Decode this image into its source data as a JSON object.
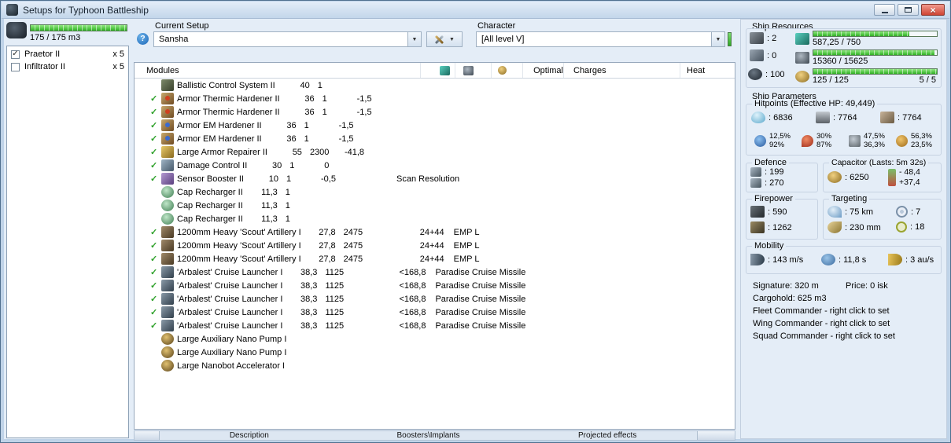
{
  "window": {
    "title": "Setups for Typhoon Battleship"
  },
  "icons": {
    "check": "✓",
    "dropdown_arrow": "▼",
    "help": "?",
    "close": "×"
  },
  "drone_bay": {
    "capacity_text": "175 / 175 m3",
    "fill_pct": 100,
    "items": [
      {
        "name": "Praetor II",
        "qty": "x 5",
        "checked": true
      },
      {
        "name": "Infiltrator II",
        "qty": "x 5",
        "checked": false
      }
    ]
  },
  "setup": {
    "current_setup_label": "Current Setup",
    "current_setup_value": "Sansha",
    "character_label": "Character",
    "character_value": "[All level V]"
  },
  "modules_table": {
    "headers": {
      "modules": "Modules",
      "optimal": "Optimal",
      "charges": "Charges",
      "heat": "Heat"
    },
    "rows": [
      {
        "active": false,
        "icon": "bcs",
        "name": "Ballistic Control System II",
        "cpu": "40",
        "pg": "1",
        "cap": "",
        "optimal": "",
        "charges": "",
        "heat": ""
      },
      {
        "active": true,
        "icon": "hard-therm",
        "name": "Armor Thermic Hardener II",
        "cpu": "36",
        "pg": "1",
        "cap": "-1,5",
        "optimal": "",
        "charges": "",
        "heat": ""
      },
      {
        "active": true,
        "icon": "hard-therm",
        "name": "Armor Thermic Hardener II",
        "cpu": "36",
        "pg": "1",
        "cap": "-1,5",
        "optimal": "",
        "charges": "",
        "heat": ""
      },
      {
        "active": true,
        "icon": "hard-em",
        "name": "Armor EM Hardener II",
        "cpu": "36",
        "pg": "1",
        "cap": "-1,5",
        "optimal": "",
        "charges": "",
        "heat": ""
      },
      {
        "active": true,
        "icon": "hard-em",
        "name": "Armor EM Hardener II",
        "cpu": "36",
        "pg": "1",
        "cap": "-1,5",
        "optimal": "",
        "charges": "",
        "heat": ""
      },
      {
        "active": true,
        "icon": "rep",
        "name": "Large Armor Repairer II",
        "cpu": "55",
        "pg": "2300",
        "cap": "-41,8",
        "optimal": "",
        "charges": "",
        "heat": ""
      },
      {
        "active": true,
        "icon": "dc",
        "name": "Damage Control II",
        "cpu": "30",
        "pg": "1",
        "cap": "0",
        "optimal": "",
        "charges": "",
        "heat": ""
      },
      {
        "active": true,
        "icon": "sb",
        "name": "Sensor Booster II",
        "cpu": "10",
        "pg": "1",
        "cap": "-0,5",
        "optimal": "",
        "charges": "Scan Resolution",
        "heat": ""
      },
      {
        "active": false,
        "icon": "capr",
        "name": "Cap Recharger II",
        "cpu": "11,3",
        "pg": "1",
        "cap": "",
        "optimal": "",
        "charges": "",
        "heat": ""
      },
      {
        "active": false,
        "icon": "capr",
        "name": "Cap Recharger II",
        "cpu": "11,3",
        "pg": "1",
        "cap": "",
        "optimal": "",
        "charges": "",
        "heat": ""
      },
      {
        "active": false,
        "icon": "capr",
        "name": "Cap Recharger II",
        "cpu": "11,3",
        "pg": "1",
        "cap": "",
        "optimal": "",
        "charges": "",
        "heat": ""
      },
      {
        "active": true,
        "icon": "arty",
        "name": "1200mm Heavy 'Scout' Artillery I",
        "cpu": "27,8",
        "pg": "2475",
        "cap": "",
        "optimal": "24+44",
        "charges": "EMP L",
        "heat": ""
      },
      {
        "active": true,
        "icon": "arty",
        "name": "1200mm Heavy 'Scout' Artillery I",
        "cpu": "27,8",
        "pg": "2475",
        "cap": "",
        "optimal": "24+44",
        "charges": "EMP L",
        "heat": ""
      },
      {
        "active": true,
        "icon": "arty",
        "name": "1200mm Heavy 'Scout' Artillery I",
        "cpu": "27,8",
        "pg": "2475",
        "cap": "",
        "optimal": "24+44",
        "charges": "EMP L",
        "heat": ""
      },
      {
        "active": true,
        "icon": "cruise",
        "name": "'Arbalest' Cruise Launcher I",
        "cpu": "38,3",
        "pg": "1125",
        "cap": "",
        "optimal": "<168,8",
        "charges": "Paradise Cruise Missile",
        "heat": ""
      },
      {
        "active": true,
        "icon": "cruise",
        "name": "'Arbalest' Cruise Launcher I",
        "cpu": "38,3",
        "pg": "1125",
        "cap": "",
        "optimal": "<168,8",
        "charges": "Paradise Cruise Missile",
        "heat": ""
      },
      {
        "active": true,
        "icon": "cruise",
        "name": "'Arbalest' Cruise Launcher I",
        "cpu": "38,3",
        "pg": "1125",
        "cap": "",
        "optimal": "<168,8",
        "charges": "Paradise Cruise Missile",
        "heat": ""
      },
      {
        "active": true,
        "icon": "cruise",
        "name": "'Arbalest' Cruise Launcher I",
        "cpu": "38,3",
        "pg": "1125",
        "cap": "",
        "optimal": "<168,8",
        "charges": "Paradise Cruise Missile",
        "heat": ""
      },
      {
        "active": true,
        "icon": "cruise",
        "name": "'Arbalest' Cruise Launcher I",
        "cpu": "38,3",
        "pg": "1125",
        "cap": "",
        "optimal": "<168,8",
        "charges": "Paradise Cruise Missile",
        "heat": ""
      },
      {
        "active": false,
        "icon": "rig",
        "name": "Large Auxiliary Nano Pump I",
        "cpu": "",
        "pg": "",
        "cap": "",
        "optimal": "",
        "charges": "",
        "heat": ""
      },
      {
        "active": false,
        "icon": "rig",
        "name": "Large Auxiliary Nano Pump I",
        "cpu": "",
        "pg": "",
        "cap": "",
        "optimal": "",
        "charges": "",
        "heat": ""
      },
      {
        "active": false,
        "icon": "rig",
        "name": "Large Nanobot Accelerator I",
        "cpu": "",
        "pg": "",
        "cap": "",
        "optimal": "",
        "charges": "",
        "heat": ""
      }
    ]
  },
  "bottom_tabs": [
    "Description",
    "Boosters\\Implants",
    "Projected effects"
  ],
  "ship_resources": {
    "title": "Ship Resources",
    "turrets": ": 2",
    "launchers": ": 0",
    "drone_bandwidth": ": 100",
    "cpu": {
      "text": "587,25 / 750",
      "pct": 78
    },
    "powergrid": {
      "text": "15360 / 15625",
      "pct": 98
    },
    "upgrades": {
      "text": "125 / 125",
      "slots": "5 / 5",
      "pct": 100
    }
  },
  "ship_parameters": {
    "title": "Ship Parameters",
    "hitpoints_title": "Hitpoints (Effective HP: 49,449)",
    "shield_hp": ": 6836",
    "armor_hp": ": 7764",
    "hull_hp": ": 7764",
    "resists": [
      {
        "type": "em",
        "top": "12,5%",
        "bottom": "92%"
      },
      {
        "type": "therm",
        "top": "30%",
        "bottom": "87%"
      },
      {
        "type": "kin",
        "top": "47,5%",
        "bottom": "36,3%"
      },
      {
        "type": "expl",
        "top": "56,3%",
        "bottom": "23,5%"
      }
    ]
  },
  "defence": {
    "title": "Defence",
    "value1": ": 199",
    "value2": ": 270"
  },
  "capacitor": {
    "title": "Capacitor (Lasts: 5m 32s)",
    "amount": ": 6250",
    "drain": "- 48,4",
    "recharge": "+37,4"
  },
  "firepower": {
    "title": "Firepower",
    "dps": ": 590",
    "volley": ": 1262"
  },
  "targeting": {
    "title": "Targeting",
    "range": ": 75 km",
    "max_targets": ": 7",
    "scan_resolution": ": 230 mm",
    "sensor_strength": ": 18"
  },
  "mobility": {
    "title": "Mobility",
    "speed": ": 143 m/s",
    "align_time": ": 11,8 s",
    "warp_speed": ": 3 au/s"
  },
  "summary": {
    "signature": "Signature: 320 m",
    "price": "Price: 0 isk",
    "cargohold": "Cargohold: 625 m3",
    "fleet": "Fleet Commander - right click to set",
    "wing": "Wing Commander - right click to set",
    "squad": "Squad Commander - right click to set"
  }
}
